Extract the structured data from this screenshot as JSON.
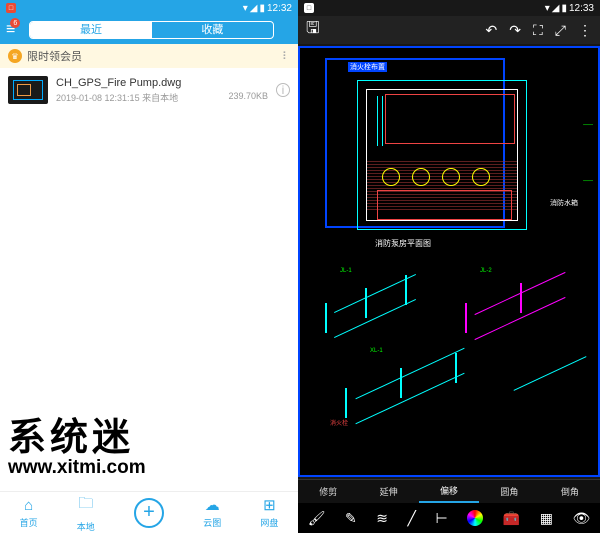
{
  "status": {
    "time": "12:32",
    "time2": "12:33"
  },
  "left": {
    "tabs": {
      "recent": "最近",
      "favorites": "收藏"
    },
    "banner": "限时领会员",
    "badge": "6",
    "file": {
      "name": "CH_GPS_Fire Pump.dwg",
      "date": "2019-01-08 12:31:15 来自本地",
      "size": "239.70KB"
    },
    "watermark_cn": "系统迷",
    "watermark_url": "www.xitmi.com",
    "nav": {
      "home": "首页",
      "local": "本地",
      "cloud": "云图",
      "disk": "网盘"
    }
  },
  "right": {
    "tools": {
      "trim": "修剪",
      "extend": "延伸",
      "offset": "偏移",
      "fillet": "圆角",
      "chamfer": "倒角"
    },
    "caption": "消防泵房平面图"
  }
}
